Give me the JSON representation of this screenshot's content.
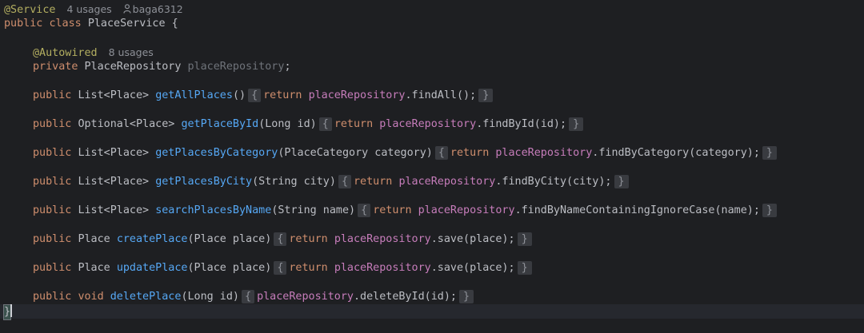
{
  "editor": {
    "hints": {
      "class_usages": "4 usages",
      "author": "baga6312",
      "field_usages": "8 usages"
    },
    "class": {
      "annotation": "@Service",
      "kw_public": "public",
      "kw_class": "class",
      "name": "PlaceService",
      "open_brace": "{",
      "close_brace": "}"
    },
    "field": {
      "annotation": "@Autowired",
      "kw_private": "private",
      "type": "PlaceRepository",
      "name": "placeRepository",
      "end": ";"
    },
    "methods": [
      {
        "modifier": "public",
        "type": "List<Place>",
        "name": "getAllPlaces",
        "params": "()",
        "ret": "return",
        "repo": "placeRepository",
        "call": ".findAll();"
      },
      {
        "modifier": "public",
        "type": "Optional<Place>",
        "name": "getPlaceById",
        "params": "(Long id)",
        "ret": "return",
        "repo": "placeRepository",
        "call": ".findById(id);"
      },
      {
        "modifier": "public",
        "type": "List<Place>",
        "name": "getPlacesByCategory",
        "params": "(PlaceCategory category)",
        "ret": "return",
        "repo": "placeRepository",
        "call": ".findByCategory(category);"
      },
      {
        "modifier": "public",
        "type": "List<Place>",
        "name": "getPlacesByCity",
        "params": "(String city)",
        "ret": "return",
        "repo": "placeRepository",
        "call": ".findByCity(city);"
      },
      {
        "modifier": "public",
        "type": "List<Place>",
        "name": "searchPlacesByName",
        "params": "(String name)",
        "ret": "return",
        "repo": "placeRepository",
        "call": ".findByNameContainingIgnoreCase(name);"
      },
      {
        "modifier": "public",
        "type": "Place",
        "name": "createPlace",
        "params": "(Place place)",
        "ret": "return",
        "repo": "placeRepository",
        "call": ".save(place);"
      },
      {
        "modifier": "public",
        "type": "Place",
        "name": "updatePlace",
        "params": "(Place place)",
        "ret": "return",
        "repo": "placeRepository",
        "call": ".save(place);"
      },
      {
        "modifier": "public",
        "kw_type": "void",
        "name": "deletePlace",
        "params": "(Long id)",
        "repo": "placeRepository",
        "call": ".deleteById(id);"
      }
    ],
    "fold_open": "{",
    "fold_close": "}"
  }
}
